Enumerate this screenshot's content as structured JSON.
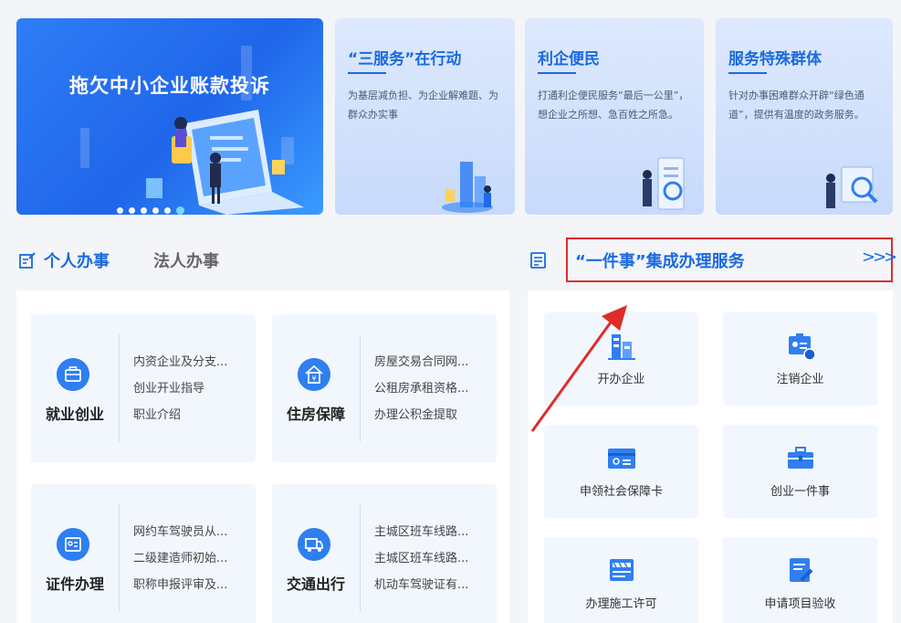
{
  "colors": {
    "accent": "#1a6ae0",
    "highlight_red": "#e02b2b",
    "icon_blue": "#2e7ff0"
  },
  "banner": {
    "title": "拖欠中小企业账款投诉",
    "dots": 6,
    "active_dot": 5
  },
  "cards": [
    {
      "title": "“三服务”在行动",
      "desc": "为基层减负担、为企业解难题、为群众办实事"
    },
    {
      "title": "利企便民",
      "desc": "打通利企便民服务“最后一公里”，想企业之所想、急百姓之所急。"
    },
    {
      "title": "服务特殊群体",
      "desc": "针对办事困难群众开辟“绿色通道”，提供有温度的政务服务。"
    }
  ],
  "tabs": {
    "personal": "个人办事",
    "corporate": "法人办事"
  },
  "onething": {
    "title": "“一件事”集成办理服务",
    "more": ">>>"
  },
  "services": [
    {
      "name": "就业创业",
      "icon": "briefcase-icon",
      "items": [
        "内资企业及分支...",
        "创业开业指导",
        "职业介绍"
      ]
    },
    {
      "name": "住房保障",
      "icon": "house-icon",
      "items": [
        "房屋交易合同网...",
        "公租房承租资格...",
        "办理公积金提取"
      ]
    },
    {
      "name": "证件办理",
      "icon": "id-card-icon",
      "items": [
        "网约车驾驶员从...",
        "二级建造师初始...",
        "职称申报评审及..."
      ]
    },
    {
      "name": "交通出行",
      "icon": "truck-icon",
      "items": [
        "主城区班车线路...",
        "主城区班车线路...",
        "机动车驾驶证有..."
      ]
    }
  ],
  "tiles": [
    {
      "label": "开办企业",
      "icon": "building-icon"
    },
    {
      "label": "注销企业",
      "icon": "cancel-license-icon"
    },
    {
      "label": "申领社会保障卡",
      "icon": "social-card-icon"
    },
    {
      "label": "创业一件事",
      "icon": "briefcase-icon"
    },
    {
      "label": "办理施工许可",
      "icon": "construction-icon"
    },
    {
      "label": "申请项目验收",
      "icon": "document-edit-icon"
    }
  ]
}
